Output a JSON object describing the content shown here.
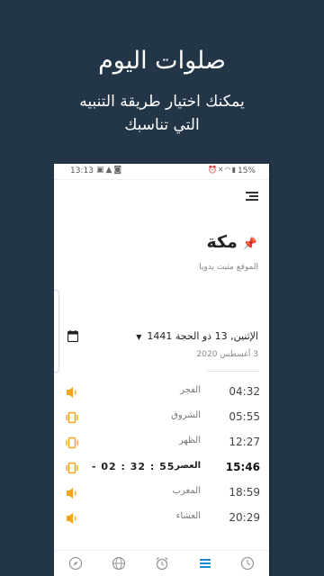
{
  "hero": {
    "title": "صلوات اليوم",
    "subtitle_line1": "يمكنك اختيار طريقة التنبيه",
    "subtitle_line2": "التي تناسبك"
  },
  "status_bar": {
    "time": "13:13",
    "battery": "15%"
  },
  "location": {
    "city": "مكة",
    "note": "الموقع مثبت يدويا"
  },
  "date": {
    "hijri": "الإثنين, 13 ذو الحجة 1441",
    "gregorian": "3 أغسطس 2020"
  },
  "prayers": [
    {
      "name": "الفجر",
      "time": "04:32",
      "alert": "sound"
    },
    {
      "name": "الشروق",
      "time": "05:55",
      "alert": "vibrate"
    },
    {
      "name": "الظهر",
      "time": "12:27",
      "alert": "vibrate"
    },
    {
      "name": "العصر",
      "time": "15:46",
      "alert": "vibrate",
      "countdown": "- 02 : 32 : 55",
      "active": true
    },
    {
      "name": "المغرب",
      "time": "18:59",
      "alert": "sound"
    },
    {
      "name": "العشاء",
      "time": "20:29",
      "alert": "sound"
    }
  ],
  "nav": [
    "compass-icon",
    "globe-icon",
    "alarm-clock-icon",
    "list-icon",
    "clock-icon"
  ],
  "colors": {
    "background": "#233648",
    "accent_orange": "#f2a51a",
    "nav_active": "#1d8bd1",
    "pin": "#1d8bd1"
  }
}
